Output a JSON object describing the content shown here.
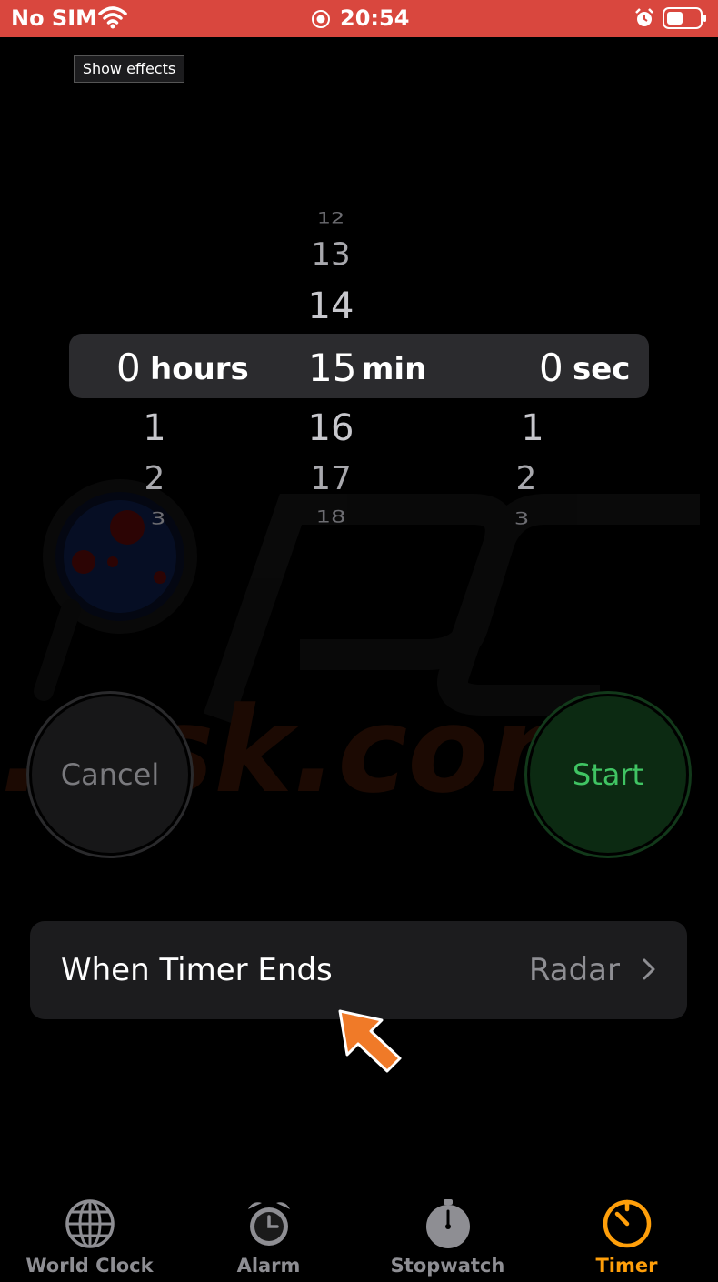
{
  "status_bar": {
    "carrier": "No SIM",
    "time": "20:54",
    "icons": [
      "wifi-icon",
      "screen-record-icon",
      "alarm-icon",
      "battery-icon"
    ]
  },
  "overlay": {
    "show_effects_label": "Show effects"
  },
  "picker": {
    "hours": {
      "above": [],
      "selected": "0",
      "unit": "hours",
      "below": [
        "1",
        "2",
        "3"
      ]
    },
    "minutes": {
      "above": [
        "12",
        "13",
        "14"
      ],
      "selected": "15",
      "unit": "min",
      "below": [
        "16",
        "17",
        "18"
      ]
    },
    "seconds": {
      "above": [],
      "selected": "0",
      "unit": "sec",
      "below": [
        "1",
        "2",
        "3"
      ]
    }
  },
  "buttons": {
    "cancel": "Cancel",
    "start": "Start"
  },
  "timer_ends": {
    "label": "When Timer Ends",
    "value": "Radar"
  },
  "tabs": [
    {
      "label": "World Clock",
      "icon": "globe-icon",
      "active": false
    },
    {
      "label": "Alarm",
      "icon": "alarm-clock-icon",
      "active": false
    },
    {
      "label": "Stopwatch",
      "icon": "stopwatch-icon",
      "active": false
    },
    {
      "label": "Timer",
      "icon": "timer-icon",
      "active": true
    }
  ],
  "watermark": {
    "text": "pcrisk.com"
  },
  "colors": {
    "status_bar": "#d9473e",
    "accent": "#ff9f0a",
    "start_green": "#40c463",
    "annotation_arrow": "#f07a28"
  }
}
